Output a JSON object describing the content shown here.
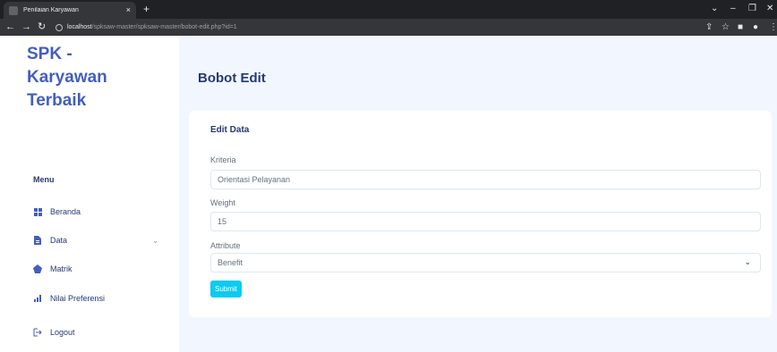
{
  "browser": {
    "tab_title": "Penilaian Karyawan",
    "tab_close": "×",
    "new_tab": "+",
    "url_host": "localhost",
    "url_path": "/spksaw-master/spksaw-master/bobot-edit.php?id=1"
  },
  "sidebar": {
    "brand_line1": "SPK -",
    "brand_line2": "Karyawan",
    "brand_line3": "Terbaik",
    "menu_title": "Menu",
    "items": [
      {
        "label": "Beranda",
        "icon": "grid-icon"
      },
      {
        "label": "Data",
        "icon": "document-icon",
        "has_submenu": true
      },
      {
        "label": "Matrik",
        "icon": "pentagon-icon"
      },
      {
        "label": "Nilai Preferensi",
        "icon": "bar-chart-icon"
      },
      {
        "label": "Logout",
        "icon": "logout-icon"
      }
    ]
  },
  "main": {
    "page_title": "Bobot Edit",
    "card_title": "Edit Data",
    "fields": {
      "kriteria_label": "Kriteria",
      "kriteria_value": "Orientasi Pelayanan",
      "weight_label": "Weight",
      "weight_value": "15",
      "attribute_label": "Attribute",
      "attribute_value": "Benefit"
    },
    "submit_label": "Submit"
  },
  "colors": {
    "brand": "#435ebe",
    "submit": "#0dcaf0",
    "background": "#f2f7ff"
  }
}
